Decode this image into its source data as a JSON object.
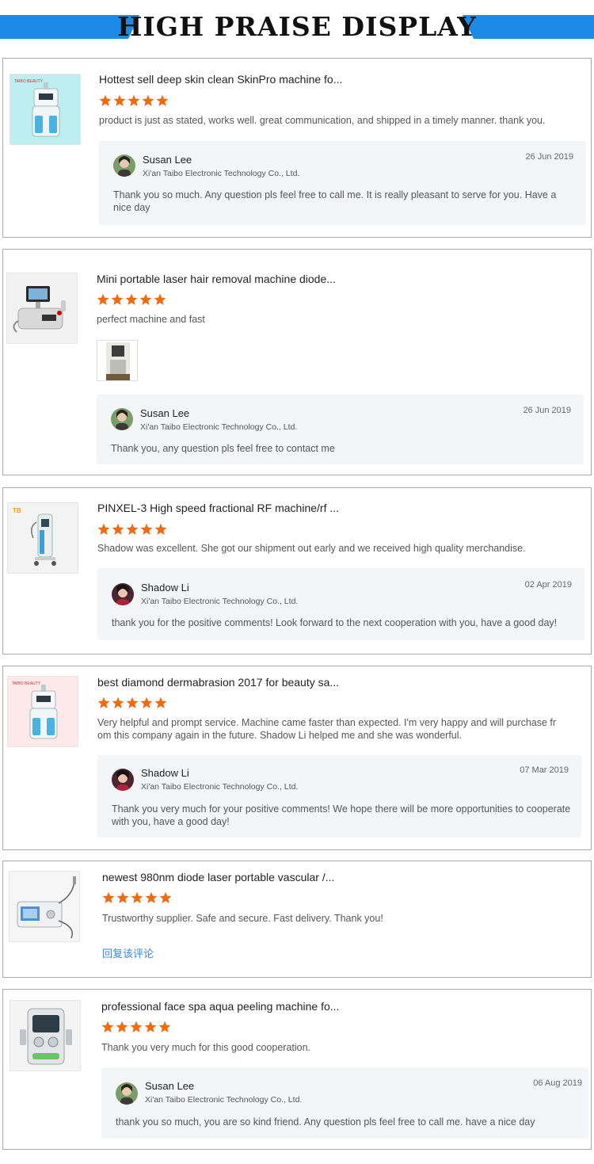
{
  "header": {
    "title": "HIGH PRAISE DISPLAY"
  },
  "colors": {
    "accent": "#1d8ae8",
    "star": "#f26a10",
    "link": "#3a88d8"
  },
  "reviews": [
    {
      "product": "Hottest sell deep skin clean SkinPro machine fo...",
      "rating": 5,
      "text": "product is just as stated, works well. great communication, and shipped in a timely manner. thank you.",
      "thumb_icon": "aqua-peel-machine-icon",
      "reply": {
        "name": "Susan Lee",
        "company": "Xi'an Taibo Electronic Technology Co., Ltd.",
        "date": "26 Jun 2019",
        "text": "Thank you so much. Any question pls feel free to call me. It is really pleasant to serve for you. Have a nice day"
      }
    },
    {
      "product": "Mini portable laser hair removal machine diode...",
      "rating": 5,
      "text": "perfect machine and fast",
      "thumb_icon": "laser-device-icon",
      "reply": {
        "name": "Susan Lee",
        "company": "Xi'an Taibo Electronic Technology Co., Ltd.",
        "date": "26 Jun 2019",
        "text": "Thank you, any question pls feel free to contact me"
      }
    },
    {
      "product": "PINXEL-3 High speed fractional RF machine/rf ...",
      "rating": 5,
      "text": "Shadow was excellent.  She got our shipment out early and we received high quality merchandise.",
      "thumb_icon": "rf-tower-machine-icon",
      "reply": {
        "name": "Shadow Li",
        "company": "Xi'an Taibo Electronic Technology Co., Ltd.",
        "date": "02 Apr 2019",
        "text": "thank you for the positive comments!  Look forward to the next cooperation with you, have a good day!"
      }
    },
    {
      "product": "best diamond dermabrasion 2017 for beauty sa...",
      "rating": 5,
      "text": "Very helpful and prompt service. Machine came faster than expected. I'm very happy and will purchase fr om this company again in the future. Shadow Li helped me and she was wonderful.",
      "thumb_icon": "aqua-peel-machine-icon",
      "reply": {
        "name": "Shadow Li",
        "company": "Xi'an Taibo Electronic Technology Co., Ltd.",
        "date": "07 Mar 2019",
        "text": "Thank you very much for your positive comments! We hope there will be more opportunities to cooperate with you, have a good day!"
      }
    },
    {
      "product": "newest 980nm diode laser portable vascular /...",
      "rating": 5,
      "text": "Trustworthy supplier. Safe and secure. Fast delivery. Thank you!",
      "thumb_icon": "diode-laser-icon",
      "reply_link": "回复该评论"
    },
    {
      "product": "professional face spa aqua peeling machine fo...",
      "rating": 5,
      "text": "Thank you very much for this good cooperation.",
      "thumb_icon": "face-spa-machine-icon",
      "reply": {
        "name": "Susan Lee",
        "company": "Xi'an Taibo Electronic Technology Co., Ltd.",
        "date": "06 Aug 2019",
        "text": "thank you so much, you are so kind friend. Any question pls feel free to call me. have a nice day"
      }
    }
  ]
}
